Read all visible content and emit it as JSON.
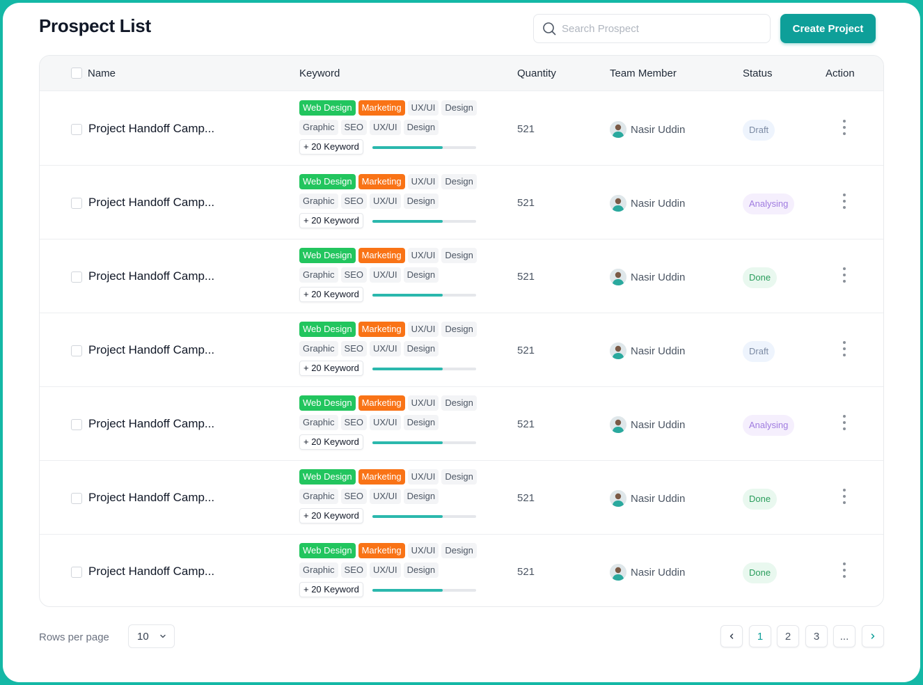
{
  "header": {
    "title": "Prospect List",
    "search_placeholder": "Search Prospect",
    "create_label": "Create Project"
  },
  "columns": {
    "name": "Name",
    "keyword": "Keyword",
    "quantity": "Quantity",
    "team_member": "Team Member",
    "status": "Status",
    "action": "Action"
  },
  "status_styles": {
    "Draft": {
      "bg": "#eef4fd",
      "fg": "#7b8aa3"
    },
    "Analysing": {
      "bg": "#f5effd",
      "fg": "#a07ce0"
    },
    "Done": {
      "bg": "#e9f8ef",
      "fg": "#2a9d5c"
    }
  },
  "rows": [
    {
      "name": "Project Handoff Camp...",
      "tags_line1": [
        "Web Design",
        "Marketing",
        "UX/UI",
        "Design"
      ],
      "tags_line2": [
        "Graphic",
        "SEO",
        "UX/UI",
        "Design"
      ],
      "more_keywords": "+ 20 Keyword",
      "progress": 0.68,
      "quantity": "521",
      "member": "Nasir Uddin",
      "status": "Draft"
    },
    {
      "name": "Project Handoff Camp...",
      "tags_line1": [
        "Web Design",
        "Marketing",
        "UX/UI",
        "Design"
      ],
      "tags_line2": [
        "Graphic",
        "SEO",
        "UX/UI",
        "Design"
      ],
      "more_keywords": "+ 20 Keyword",
      "progress": 0.68,
      "quantity": "521",
      "member": "Nasir Uddin",
      "status": "Analysing"
    },
    {
      "name": "Project Handoff Camp...",
      "tags_line1": [
        "Web Design",
        "Marketing",
        "UX/UI",
        "Design"
      ],
      "tags_line2": [
        "Graphic",
        "SEO",
        "UX/UI",
        "Design"
      ],
      "more_keywords": "+ 20 Keyword",
      "progress": 0.68,
      "quantity": "521",
      "member": "Nasir Uddin",
      "status": "Done"
    },
    {
      "name": "Project Handoff Camp...",
      "tags_line1": [
        "Web Design",
        "Marketing",
        "UX/UI",
        "Design"
      ],
      "tags_line2": [
        "Graphic",
        "SEO",
        "UX/UI",
        "Design"
      ],
      "more_keywords": "+ 20 Keyword",
      "progress": 0.68,
      "quantity": "521",
      "member": "Nasir Uddin",
      "status": "Draft"
    },
    {
      "name": "Project Handoff Camp...",
      "tags_line1": [
        "Web Design",
        "Marketing",
        "UX/UI",
        "Design"
      ],
      "tags_line2": [
        "Graphic",
        "SEO",
        "UX/UI",
        "Design"
      ],
      "more_keywords": "+ 20 Keyword",
      "progress": 0.68,
      "quantity": "521",
      "member": "Nasir Uddin",
      "status": "Analysing"
    },
    {
      "name": "Project Handoff Camp...",
      "tags_line1": [
        "Web Design",
        "Marketing",
        "UX/UI",
        "Design"
      ],
      "tags_line2": [
        "Graphic",
        "SEO",
        "UX/UI",
        "Design"
      ],
      "more_keywords": "+ 20 Keyword",
      "progress": 0.68,
      "quantity": "521",
      "member": "Nasir Uddin",
      "status": "Done"
    },
    {
      "name": "Project Handoff Camp...",
      "tags_line1": [
        "Web Design",
        "Marketing",
        "UX/UI",
        "Design"
      ],
      "tags_line2": [
        "Graphic",
        "SEO",
        "UX/UI",
        "Design"
      ],
      "more_keywords": "+ 20 Keyword",
      "progress": 0.68,
      "quantity": "521",
      "member": "Nasir Uddin",
      "status": "Done"
    }
  ],
  "footer": {
    "rows_per_page_label": "Rows per page",
    "rows_per_page_value": "10",
    "pages": [
      "1",
      "2",
      "3",
      "..."
    ],
    "active_page": "1"
  }
}
